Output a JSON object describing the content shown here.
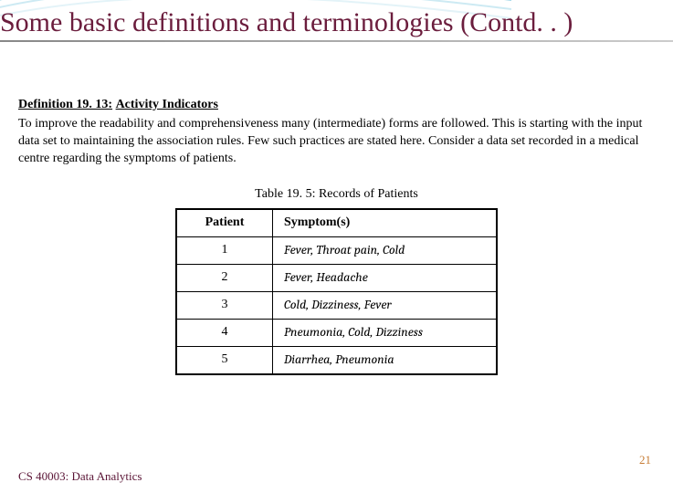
{
  "title": "Some basic definitions and terminologies (Contd. . )",
  "definition": {
    "label": "Definition 19. 13:",
    "name": "Activity Indicators",
    "text": "To improve the readability and comprehensiveness many (intermediate) forms are followed. This is starting with the input data set to maintaining the association rules. Few such practices are stated here. Consider a data set recorded in a medical centre regarding the symptoms of patients."
  },
  "table": {
    "caption": "Table 19. 5: Records of Patients",
    "headers": {
      "col1": "Patient",
      "col2": "Symptom(s)"
    },
    "rows": [
      {
        "patient": "1",
        "symptoms": "Fever, Throat pain, Cold"
      },
      {
        "patient": "2",
        "symptoms": "Fever, Headache"
      },
      {
        "patient": "3",
        "symptoms": "Cold, Dizziness, Fever"
      },
      {
        "patient": "4",
        "symptoms": "Pneumonia, Cold, Dizziness"
      },
      {
        "patient": "5",
        "symptoms": "Diarrhea, Pneumonia"
      }
    ]
  },
  "footer": {
    "left": "CS 40003: Data Analytics",
    "right": "21"
  }
}
